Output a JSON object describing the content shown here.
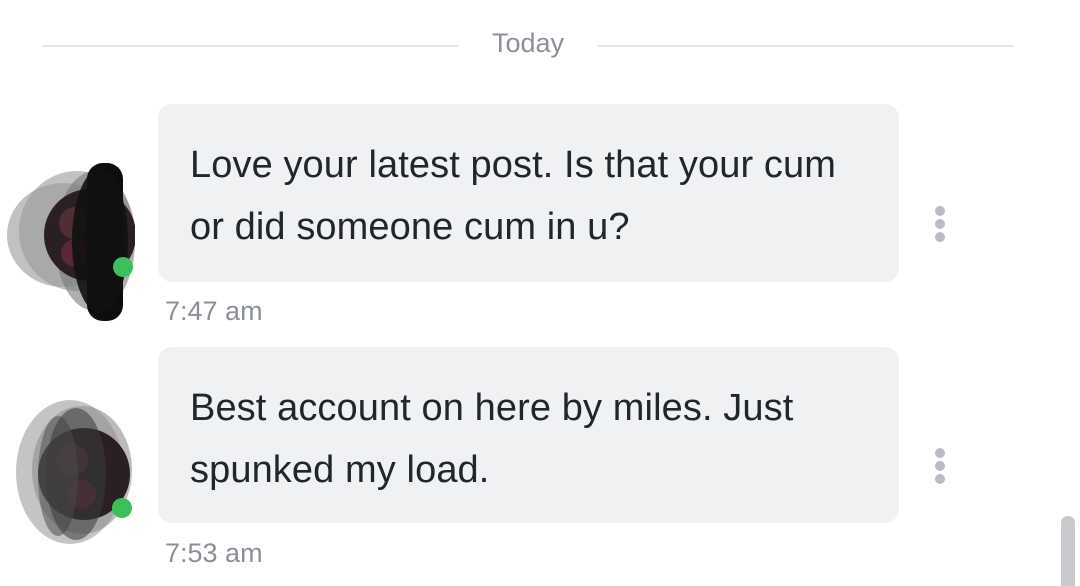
{
  "divider": {
    "label": "Today"
  },
  "messages": [
    {
      "text": "Love your latest post. Is that your cum or did someone cum in u?",
      "time": "7:47 am",
      "online": true
    },
    {
      "text": "Best account on here by miles. Just spunked my load.",
      "time": "7:53 am",
      "online": true
    }
  ],
  "icons": {
    "more": "more-vertical-icon",
    "status": "online-status-dot"
  },
  "colors": {
    "bubble": "#f0f1f3",
    "text": "#22252a",
    "muted": "#8b9098",
    "online": "#3fbf5b"
  }
}
